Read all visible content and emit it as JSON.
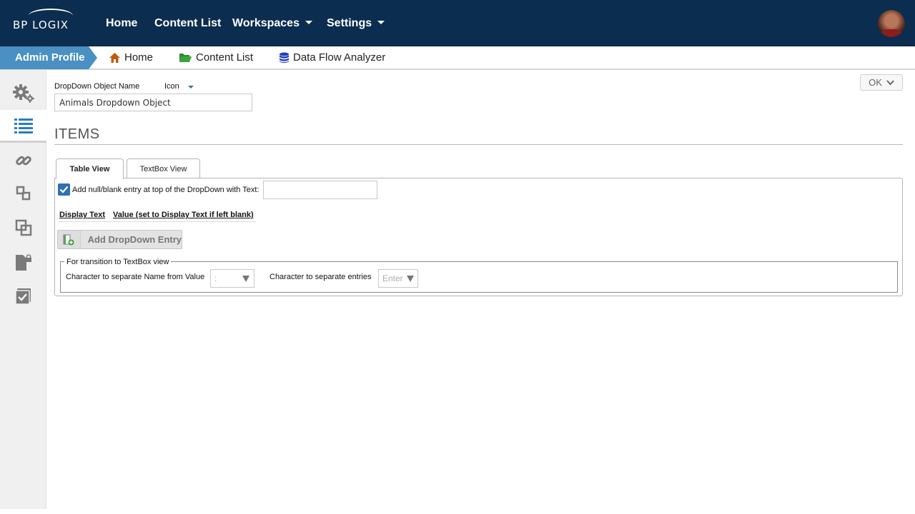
{
  "brand": {
    "logo_text": "BP LOGIX"
  },
  "topnav": {
    "items": [
      {
        "label": "Home"
      },
      {
        "label": "Content List"
      },
      {
        "label": "Workspaces"
      },
      {
        "label": "Settings"
      }
    ]
  },
  "breadcrumb": {
    "profile": "Admin Profile",
    "links": [
      {
        "label": "Home",
        "icon": "home-icon",
        "color": "#c05a0a"
      },
      {
        "label": "Content List",
        "icon": "folder-open-icon",
        "color": "#2e8b2e"
      },
      {
        "label": "Data Flow Analyzer",
        "icon": "database-icon",
        "color": "#1f3fbf"
      }
    ]
  },
  "sidebar": {
    "items": [
      {
        "icon": "gears-icon"
      },
      {
        "icon": "list-icon",
        "active": true
      },
      {
        "icon": "link-icon"
      },
      {
        "icon": "relation-icon"
      },
      {
        "icon": "copy-icon"
      },
      {
        "icon": "locked-file-icon"
      },
      {
        "icon": "checklist-icon"
      }
    ]
  },
  "form": {
    "object_name_label": "DropDown Object Name",
    "icon_label": "Icon",
    "object_name_value": "Animals Dropdown Object",
    "ok_label": "OK"
  },
  "items_section": {
    "title": "ITEMS",
    "tabs": [
      {
        "label": "Table View",
        "active": true
      },
      {
        "label": "TextBox View",
        "active": false
      }
    ],
    "null_entry_checked": true,
    "null_entry_label": "Add null/blank entry at top of the DropDown with Text:",
    "null_entry_value": "",
    "columns": [
      "Display Text",
      "Value (set to Display Text if left blank)"
    ],
    "add_button_label": "Add DropDown Entry",
    "transition_legend": "For transition to TextBox view",
    "name_value_sep_label": "Character to separate Name from Value",
    "name_value_sep_value": ":",
    "entries_sep_label": "Character to separate entries",
    "entries_sep_value": "Enter"
  },
  "colors": {
    "topnav_bg": "#0b2d4f",
    "profile_tab": "#4a90c2",
    "checkbox": "#2f6fb2",
    "sidebar_active_icon": "#2b7cc0",
    "sidebar_icon": "#7a7a7a"
  }
}
